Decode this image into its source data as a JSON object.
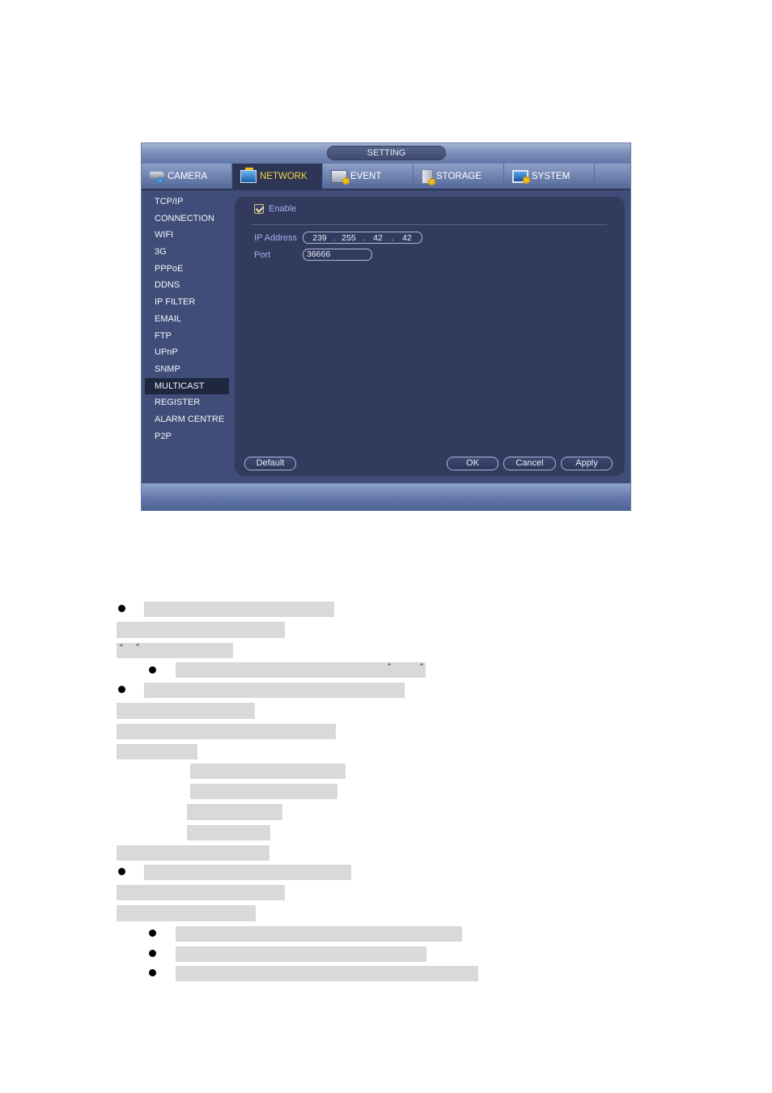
{
  "window": {
    "title": "SETTING"
  },
  "tabs": [
    {
      "label": "CAMERA",
      "icon": "camera-icon",
      "active": false
    },
    {
      "label": "NETWORK",
      "icon": "network-icon",
      "active": true
    },
    {
      "label": "EVENT",
      "icon": "event-icon",
      "active": false
    },
    {
      "label": "STORAGE",
      "icon": "storage-icon",
      "active": false
    },
    {
      "label": "SYSTEM",
      "icon": "system-icon",
      "active": false
    }
  ],
  "sidebar": {
    "items": [
      {
        "label": "TCP/IP"
      },
      {
        "label": "CONNECTION"
      },
      {
        "label": "WIFI"
      },
      {
        "label": "3G"
      },
      {
        "label": "PPPoE"
      },
      {
        "label": "DDNS"
      },
      {
        "label": "IP FILTER"
      },
      {
        "label": "EMAIL"
      },
      {
        "label": "FTP"
      },
      {
        "label": "UPnP"
      },
      {
        "label": "SNMP"
      },
      {
        "label": "MULTICAST",
        "active": true
      },
      {
        "label": "REGISTER"
      },
      {
        "label": "ALARM CENTRE"
      },
      {
        "label": "P2P"
      }
    ]
  },
  "multicast": {
    "enable_label": "Enable",
    "enable_checked": true,
    "ip_label": "IP Address",
    "ip": [
      "239",
      "255",
      "42",
      "42"
    ],
    "ip_sep": ".",
    "port_label": "Port",
    "port": "36666"
  },
  "buttons": {
    "default": "Default",
    "ok": "OK",
    "cancel": "Cancel",
    "apply": "Apply"
  },
  "document": {
    "quote_open": "“",
    "quote_close": "”",
    "note": "Text below the screenshot is redacted (grey blocks)."
  },
  "colors": {
    "active_tab_text": "#f3d240",
    "panel_bg": "#323b5e",
    "window_bg": "#3f4d78",
    "label_text": "#9fb3ee",
    "redaction": "#d9d9d9"
  }
}
